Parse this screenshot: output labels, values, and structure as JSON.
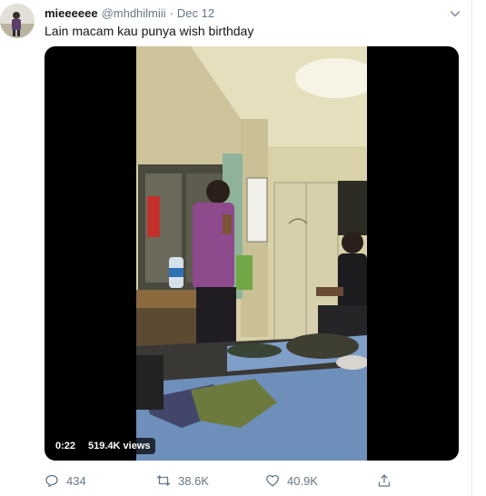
{
  "tweet": {
    "author": {
      "display_name": "mieeeeee",
      "handle": "@mhdhilmiii"
    },
    "separator": "·",
    "date": "Dec 12",
    "text": "Lain macam kau punya wish birthday",
    "video": {
      "duration": "0:22",
      "views": "519.4K views"
    },
    "actions": {
      "replies": "434",
      "retweets": "38.6K",
      "likes": "40.9K"
    }
  },
  "icons": {
    "reply": "reply-icon",
    "retweet": "retweet-icon",
    "like": "heart-icon",
    "share": "share-icon",
    "more": "chevron-down-icon"
  },
  "colors": {
    "text_primary": "#14171a",
    "text_secondary": "#657786",
    "divider": "#e6ecf0"
  }
}
